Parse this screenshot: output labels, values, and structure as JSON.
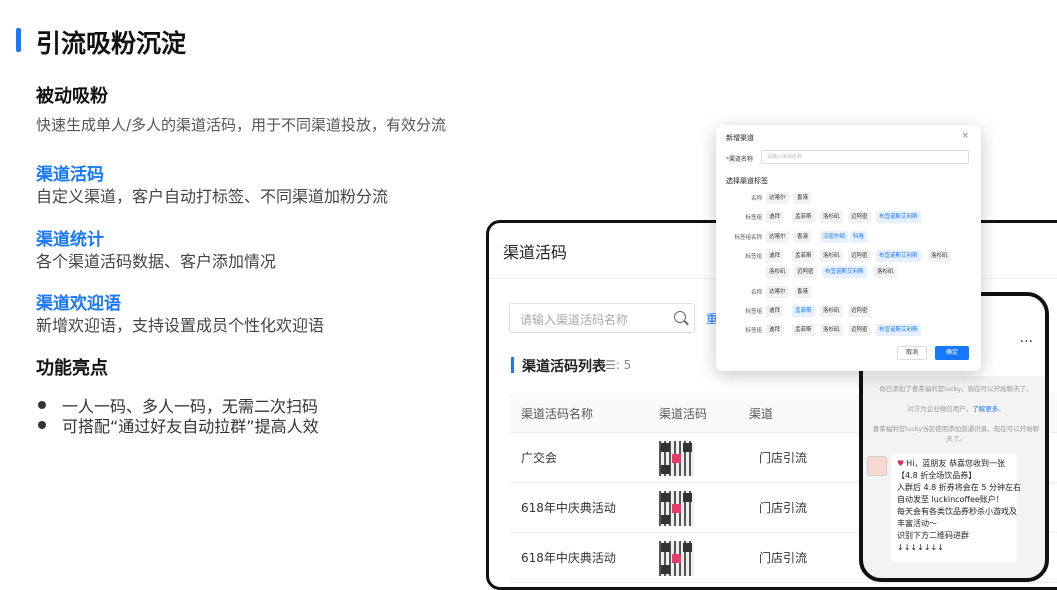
{
  "slide": {
    "title": "引流吸粉沉淀",
    "passive": {
      "heading": "被动吸粉",
      "desc": "快速生成单人/多人的渠道活码，用于不同渠道投放，有效分流"
    },
    "features": [
      {
        "name": "渠道活码",
        "desc": "自定义渠道，客户自动打标签、不同渠道加粉分流"
      },
      {
        "name": "渠道统计",
        "desc": "各个渠道活码数据、客户添加情况"
      },
      {
        "name": "渠道欢迎语",
        "desc": "新增欢迎语，支持设置成员个性化欢迎语"
      }
    ],
    "highlights": {
      "heading": "功能亮点",
      "items": [
        "一人一码、多人一码，无需二次扫码",
        "可搭配“通过好友自动拉群”提高人效"
      ]
    }
  },
  "tablet": {
    "title": "渠道活码",
    "search_placeholder": "请输入渠道活码名称",
    "reset_label": "重",
    "list_title": "渠道活码列表",
    "list_count": "☰: 5",
    "columns": [
      "渠道活码名称",
      "渠道活码",
      "渠道"
    ],
    "rows": [
      {
        "name": "广交会",
        "channel": "门店引流"
      },
      {
        "name": "618年中庆典活动",
        "channel": "门店引流"
      },
      {
        "name": "618年中庆典活动",
        "channel": "门店引流"
      }
    ]
  },
  "modal": {
    "title": "新增渠道",
    "close": "×",
    "name_label": "渠道名称",
    "name_placeholder": "请输入渠道名称",
    "section_label": "选择渠道标签",
    "rows": [
      {
        "label": "名称",
        "indent": false,
        "tags": [
          {
            "t": "达喀尔",
            "sel": false
          },
          {
            "t": "香港",
            "sel": false
          }
        ]
      },
      {
        "label": "标签组",
        "indent": true,
        "tags": [
          {
            "t": "迪拜",
            "sel": false
          },
          {
            "t": "孟菲斯",
            "sel": false
          },
          {
            "t": "洛杉矶",
            "sel": false
          },
          {
            "t": "迈阿密",
            "sel": false
          },
          {
            "t": "布宜诺斯艾利斯",
            "sel": true
          }
        ]
      },
      {
        "label": "标签组名称",
        "indent": false,
        "tags": [
          {
            "t": "达喀尔",
            "sel": false
          },
          {
            "t": "香港",
            "sel": false
          },
          {
            "t": "汉密尔顿",
            "sel": true
          },
          {
            "t": "科隆",
            "sel": true
          }
        ]
      },
      {
        "label": "标签组",
        "indent": true,
        "tags": [
          {
            "t": "迪拜",
            "sel": false
          },
          {
            "t": "孟菲斯",
            "sel": false
          },
          {
            "t": "洛杉矶",
            "sel": false
          },
          {
            "t": "迈阿密",
            "sel": false
          },
          {
            "t": "布宜诺斯艾利斯",
            "sel": true
          },
          {
            "t": "洛杉矶",
            "sel": false
          }
        ]
      },
      {
        "label": "",
        "indent": true,
        "tags": [
          {
            "t": "洛杉矶",
            "sel": false
          },
          {
            "t": "迈阿密",
            "sel": false
          },
          {
            "t": "布宜诺斯艾利斯",
            "sel": true
          },
          {
            "t": "洛杉矶",
            "sel": false
          }
        ]
      },
      {
        "label": "名称",
        "indent": false,
        "tags": [
          {
            "t": "达喀尔",
            "sel": false
          },
          {
            "t": "香港",
            "sel": false
          }
        ]
      },
      {
        "label": "标签组",
        "indent": true,
        "tags": [
          {
            "t": "迪拜",
            "sel": false
          },
          {
            "t": "孟菲斯",
            "sel": true
          },
          {
            "t": "洛杉矶",
            "sel": false
          },
          {
            "t": "迈阿密",
            "sel": false
          }
        ]
      },
      {
        "label": "标签组",
        "indent": true,
        "tags": [
          {
            "t": "迪拜",
            "sel": false
          },
          {
            "t": "孟菲斯",
            "sel": false
          },
          {
            "t": "洛杉矶",
            "sel": false
          },
          {
            "t": "迈阿密",
            "sel": false
          },
          {
            "t": "布宜诺斯艾利斯",
            "sel": true
          }
        ]
      }
    ],
    "cancel_label": "取消",
    "ok_label": "确定"
  },
  "phone": {
    "dots": "...",
    "sys1": "你已添加了喜茶福利官lucky，现在可以开始聊天了。",
    "sys2_a": "对方为企业微信用户，",
    "sys2_link": "了解更多",
    "sys2_b": "。",
    "sys3": "喜茶福利官lucky当前使用添加到通讯录，现在可以开始聊天了。",
    "lines": [
      "Hi，蓝朋友 恭喜您收到一张",
      "【4.8 折全场饮品券】",
      "入群后 4.8 折券将会在 5 分钟左右",
      "自动发至 luckincoffee账户！",
      "每天会有各类饮品券秒杀小游戏及",
      "丰富活动～",
      "识别下方二维码进群",
      "↓↓↓↓↓↓↓"
    ]
  }
}
